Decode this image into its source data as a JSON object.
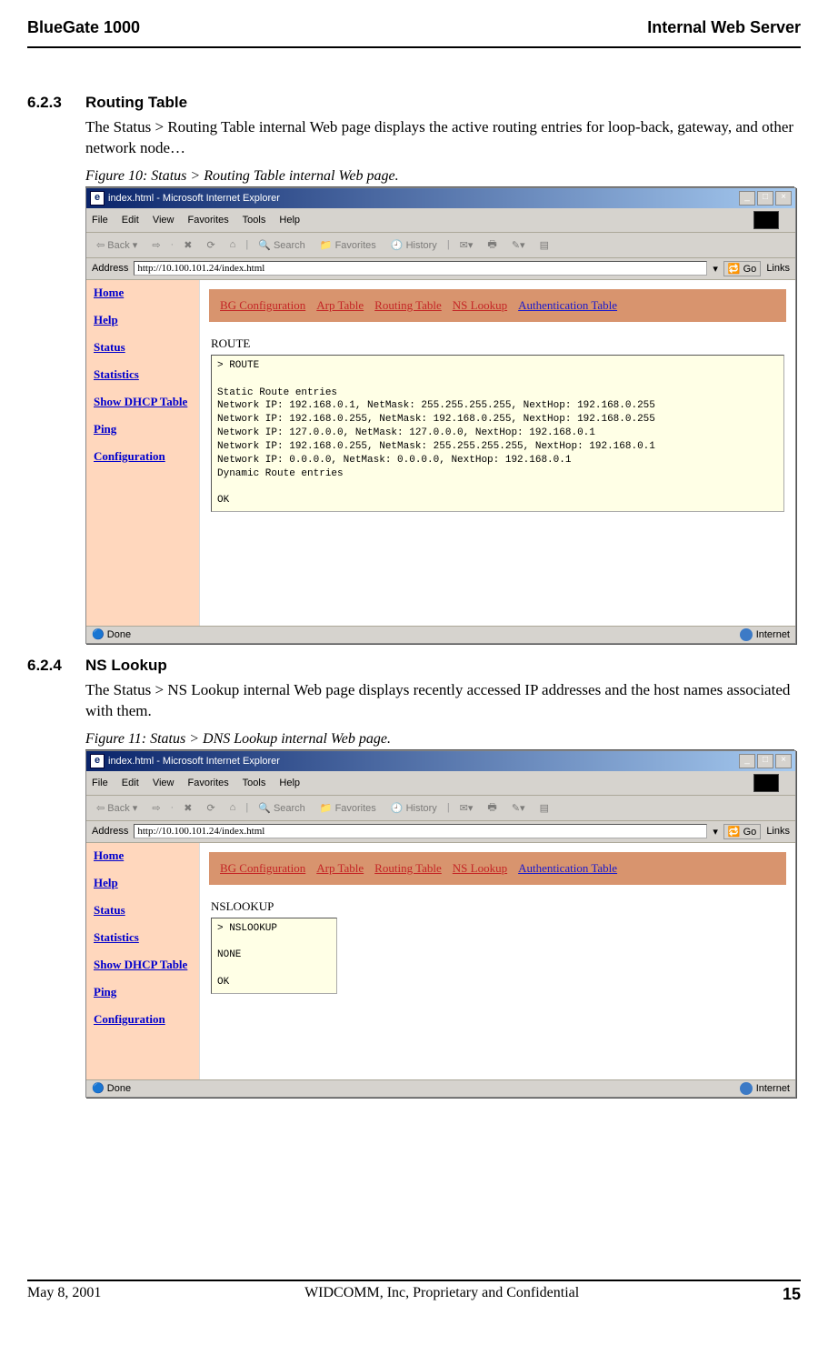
{
  "header": {
    "left": "BlueGate 1000",
    "right": "Internal Web Server"
  },
  "footer": {
    "left": "May 8, 2001",
    "center": "WIDCOMM, Inc, Proprietary and Confidential",
    "page": "15"
  },
  "section_623": {
    "number": "6.2.3",
    "title": "Routing Table",
    "body": "The Status > Routing Table internal Web page displays the active routing entries for loop-back, gateway, and other network node…",
    "caption": "Figure 10: Status > Routing Table internal Web page."
  },
  "section_624": {
    "number": "6.2.4",
    "title": "NS Lookup",
    "body": "The Status > NS Lookup internal Web page displays recently accessed IP addresses and the host names associated with them.",
    "caption": "Figure 11: Status > DNS Lookup internal Web page."
  },
  "ie": {
    "title": "index.html - Microsoft Internet Explorer",
    "menus": {
      "file": "File",
      "edit": "Edit",
      "view": "View",
      "favorites": "Favorites",
      "tools": "Tools",
      "help": "Help"
    },
    "toolbar": {
      "back": "Back",
      "search": "Search",
      "favorites": "Favorites",
      "history": "History"
    },
    "address_label": "Address",
    "address_value": "http://10.100.101.24/index.html",
    "go": "Go",
    "links": "Links",
    "leftnav": {
      "home": "Home",
      "help": "Help",
      "status": "Status",
      "statistics": "Statistics",
      "dhcp": "Show DHCP Table",
      "ping": "Ping",
      "config": "Configuration"
    },
    "tabs": {
      "bg": "BG Configuration",
      "arp": "Arp Table",
      "routing": "Routing Table",
      "ns": "NS Lookup",
      "auth": "Authentication Table"
    },
    "status": {
      "done": "Done",
      "zone": "Internet"
    },
    "route": {
      "title": "ROUTE",
      "output": "> ROUTE\n\nStatic Route entries\nNetwork IP: 192.168.0.1, NetMask: 255.255.255.255, NextHop: 192.168.0.255\nNetwork IP: 192.168.0.255, NetMask: 192.168.0.255, NextHop: 192.168.0.255\nNetwork IP: 127.0.0.0, NetMask: 127.0.0.0, NextHop: 192.168.0.1\nNetwork IP: 192.168.0.255, NetMask: 255.255.255.255, NextHop: 192.168.0.1\nNetwork IP: 0.0.0.0, NetMask: 0.0.0.0, NextHop: 192.168.0.1\nDynamic Route entries\n\nOK"
    },
    "nslookup": {
      "title": "NSLOOKUP",
      "output": "> NSLOOKUP\n\nNONE\n\nOK"
    }
  }
}
